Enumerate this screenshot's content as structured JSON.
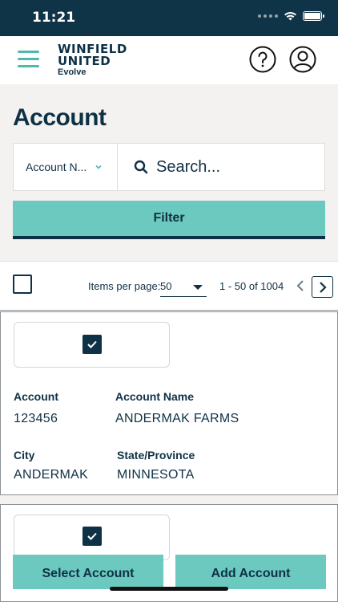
{
  "status_bar": {
    "time": "11:21"
  },
  "header": {
    "logo_line1": "WINFIELD",
    "logo_line2": "UNITED",
    "logo_line3": "Evolve"
  },
  "page": {
    "title": "Account"
  },
  "search": {
    "field_select": "Account N...",
    "placeholder": "Search..."
  },
  "filter": {
    "label": "Filter"
  },
  "pagination": {
    "items_per_page_label": "Items per page:",
    "items_per_page_value": "50",
    "range": "1 - 50 of 1004"
  },
  "accounts": [
    {
      "checked": true,
      "account_label": "Account",
      "account_value": "123456",
      "name_label": "Account Name",
      "name_value": "ANDERMAK FARMS",
      "city_label": "City",
      "city_value": "ANDERMAK",
      "state_label": "State/Province",
      "state_value": "MINNESOTA"
    },
    {
      "checked": true
    }
  ],
  "actions": {
    "select_account": "Select Account",
    "add_account": "Add Account"
  },
  "colors": {
    "navy": "#0f3145",
    "teal": "#6cc9bf",
    "status_bar": "#0f3347",
    "background": "#f3f2f1"
  }
}
